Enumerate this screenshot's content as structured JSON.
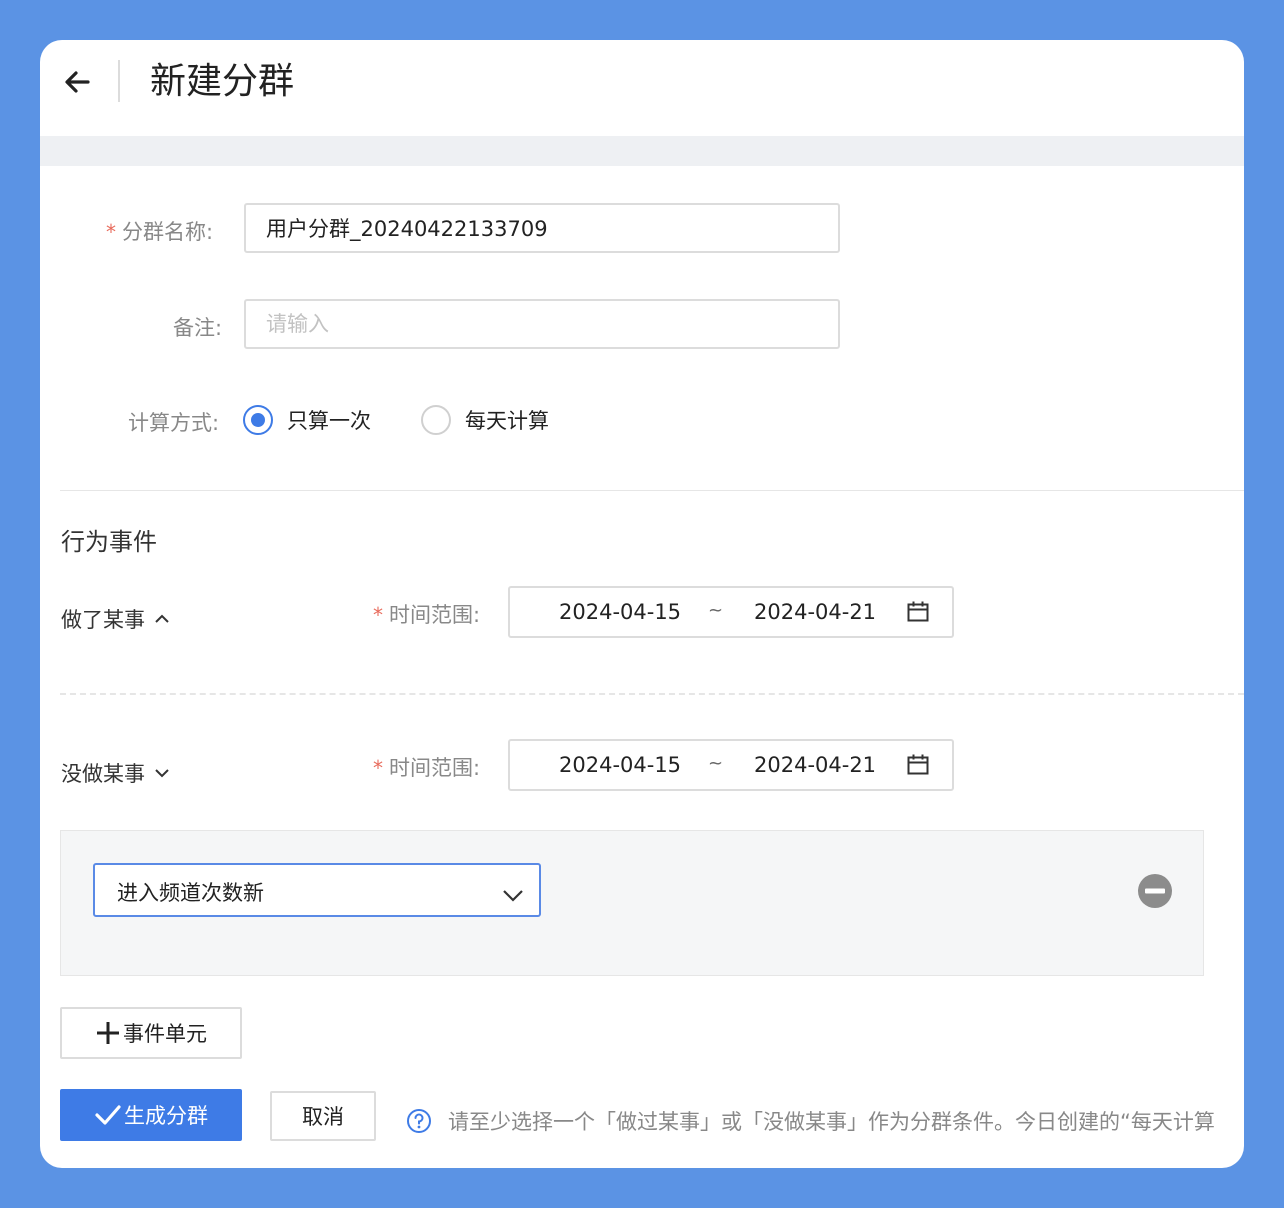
{
  "header": {
    "title": "新建分群"
  },
  "form": {
    "name_label": "分群名称:",
    "name_value": "用户分群_20240422133709",
    "note_label": "备注:",
    "note_placeholder": "请输入",
    "calc_label": "计算方式:",
    "calc_options": [
      {
        "label": "只算一次",
        "checked": true
      },
      {
        "label": "每天计算",
        "checked": false
      }
    ]
  },
  "behavior": {
    "section_title": "行为事件",
    "did": {
      "label": "做了某事",
      "time_label": "时间范围:",
      "start": "2024-04-15",
      "separator": "~",
      "end": "2024-04-21"
    },
    "not_did": {
      "label": "没做某事",
      "time_label": "时间范围:",
      "start": "2024-04-15",
      "separator": "~",
      "end": "2024-04-21",
      "condition_value": "进入频道次数新"
    }
  },
  "actions": {
    "add_unit_label": "事件单元",
    "generate_label": "生成分群",
    "cancel_label": "取消",
    "hint": "请至少选择一个「做过某事」或「没做某事」作为分群条件。今日创建的“每天计算"
  },
  "colors": {
    "background": "#5b93e4",
    "primary": "#3e7be6",
    "required": "#e86b5c"
  },
  "icons": [
    "back-arrow-icon",
    "chevron-up-icon",
    "chevron-down-icon",
    "calendar-icon",
    "remove-circle-icon",
    "plus-icon",
    "check-icon",
    "question-circle-icon"
  ]
}
